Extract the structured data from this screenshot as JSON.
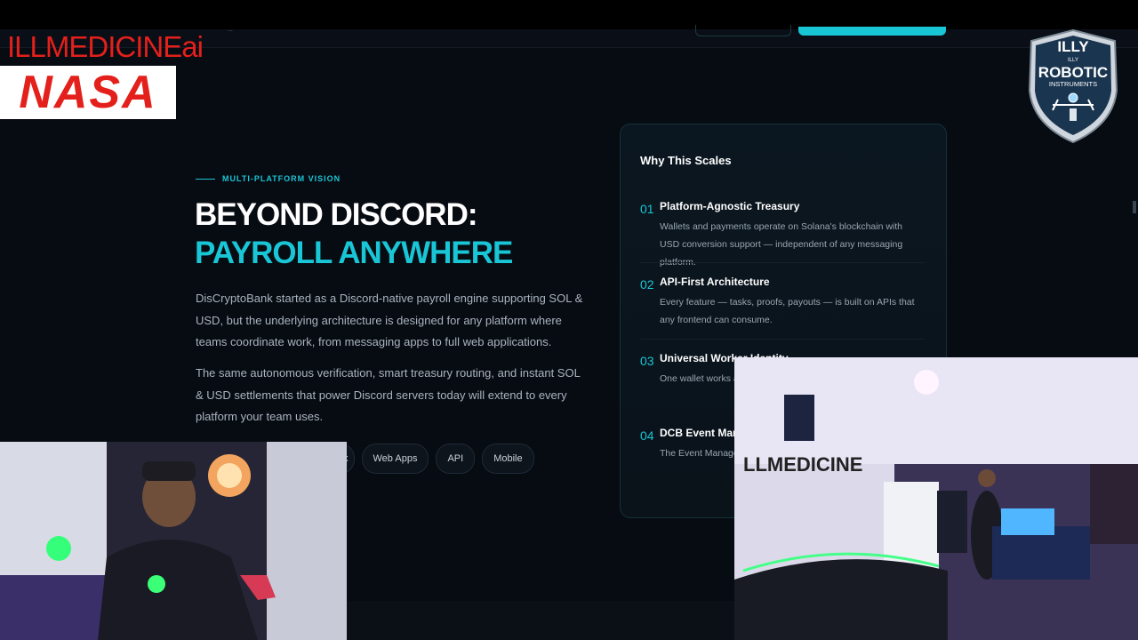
{
  "overlay": {
    "brand_text": "ILLMEDICINEai",
    "nasa_logo_text": "NASA",
    "badge": {
      "line1": "ILLY",
      "line2": "ROBOTIC",
      "line3": "INSTRUMENTS",
      "small": "ILLY"
    }
  },
  "nav": {
    "tiny_text": "..."
  },
  "hero": {
    "eyebrow": "MULTI-PLATFORM VISION",
    "headline_line1": "BEYOND DISCORD:",
    "headline_line2": "PAYROLL ANYWHERE",
    "paragraph1": "DisCryptoBank started as a Discord-native payroll engine supporting SOL & USD, but the underlying architecture is designed for any platform where teams coordinate work, from messaging apps to full web applications.",
    "paragraph2": "The same autonomous verification, smart treasury routing, and instant SOL & USD settlements that power Discord servers today will extend to every platform your team uses.",
    "chips": [
      "k",
      "Web Apps",
      "API",
      "Mobile"
    ]
  },
  "card": {
    "title": "Why This Scales",
    "items": [
      {
        "num": "01",
        "title": "Platform-Agnostic Treasury",
        "desc": "Wallets and payments operate on Solana's blockchain with USD conversion support — independent of any messaging platform."
      },
      {
        "num": "02",
        "title": "API-First Architecture",
        "desc": "Every feature — tasks, proofs, payouts — is built on APIs that any frontend can consume."
      },
      {
        "num": "03",
        "title": "Universal Worker Identity",
        "desc": "One wallet works a... need separate acc..."
      },
      {
        "num": "04",
        "title": "DCB Event Mana...",
        "desc": "The Event Manage... standalone web ap..."
      }
    ]
  },
  "webcam_right": {
    "wall_text": "LLMEDICINE"
  }
}
